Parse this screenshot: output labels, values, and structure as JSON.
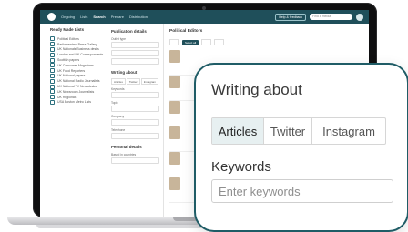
{
  "app": {
    "nav": [
      "Ongoing",
      "Lists",
      "Search",
      "Prepare",
      "Distribution"
    ],
    "feedback_label": "Help & feedback",
    "search_placeholder": "Find a media"
  },
  "lists_panel": {
    "title": "Ready Made Lists",
    "items": [
      "Political Editors",
      "Parliamentary Press Gallery",
      "UK Nationals Business desks",
      "London and UK Correspondents",
      "Scottish papers",
      "UK Consumer Magazines",
      "UK Food Reporters",
      "UK National papers",
      "UK National Radio Journalists",
      "UK National TV Newsdesks",
      "UK Newsroom Journalists",
      "UK Regionals",
      "USA Boston Metro Lists"
    ]
  },
  "filter_panel": {
    "publication_heading": "Publication details",
    "outlet_type_label": "Outlet type",
    "writing_about_heading": "Writing about",
    "mini_tabs": [
      "Articles",
      "Twitter",
      "Instagram"
    ],
    "keywords_label": "Keywords",
    "topic_label": "Topic",
    "company_label": "Company",
    "telephone_label": "Telephone",
    "personal_heading": "Personal details",
    "based_in_label": "Based in countries"
  },
  "results_panel": {
    "title": "Political Editors",
    "select_all_label": "Select all"
  },
  "writing_about": {
    "title": "Writing about",
    "tabs": [
      "Articles",
      "Twitter",
      "Instagram"
    ],
    "active_tab": "Articles",
    "keywords_label": "Keywords",
    "keywords_placeholder": "Enter keywords",
    "keywords_value": ""
  },
  "colors": {
    "brand": "#1f4f5a",
    "callout_border": "#1f5c66",
    "active_tab_bg": "#e7f0f1"
  }
}
